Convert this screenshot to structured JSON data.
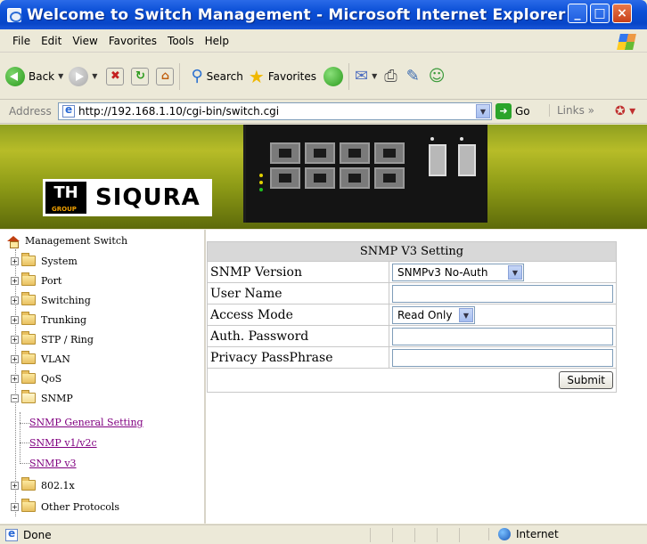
{
  "window": {
    "title": "Welcome to Switch Management - Microsoft Internet Explorer",
    "minimize": "_",
    "maximize": "□",
    "close": "×"
  },
  "menu": [
    "File",
    "Edit",
    "View",
    "Favorites",
    "Tools",
    "Help"
  ],
  "toolbar": {
    "back": "Back",
    "search": "Search",
    "favorites": "Favorites"
  },
  "address": {
    "label": "Address",
    "url": "http://192.168.1.10/cgi-bin/switch.cgi",
    "go": "Go",
    "links": "Links"
  },
  "banner": {
    "logo_th": "TH",
    "logo_group": "GROUP",
    "logo_text": "SIQURA"
  },
  "sidebar": {
    "root": "Management Switch",
    "items": [
      "System",
      "Port",
      "Switching",
      "Trunking",
      "STP / Ring",
      "VLAN",
      "QoS",
      "SNMP"
    ],
    "snmp_children": [
      "SNMP General Setting",
      "SNMP v1/v2c",
      "SNMP v3"
    ],
    "after": [
      "802.1x",
      "Other Protocols"
    ]
  },
  "form": {
    "header": "SNMP V3 Setting",
    "rows": {
      "version_label": "SNMP Version",
      "version_value": "SNMPv3 No-Auth",
      "username_label": "User Name",
      "username_value": "",
      "access_label": "Access Mode",
      "access_value": "Read Only",
      "authpw_label": "Auth. Password",
      "authpw_value": "",
      "privacy_label": "Privacy PassPhrase",
      "privacy_value": ""
    },
    "submit": "Submit"
  },
  "status": {
    "text": "Done",
    "zone": "Internet"
  },
  "colors": {
    "titlebar": "#0a4fd6",
    "banner": "#a4b020",
    "visited_link": "#800080"
  }
}
